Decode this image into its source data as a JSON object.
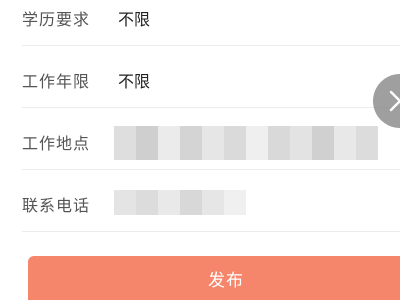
{
  "form": {
    "education": {
      "label": "学历要求",
      "value": "不限"
    },
    "work_years": {
      "label": "工作年限",
      "value": "不限"
    },
    "work_location": {
      "label": "工作地点"
    },
    "phone": {
      "label": "联系电话"
    }
  },
  "masks": {
    "location_cells": [
      "#dedede",
      "#cfcfcf",
      "#ebebeb",
      "#d4d4d4",
      "#e6e6e6",
      "#dadada",
      "#efefef",
      "#d9d9d9",
      "#e3e3e3",
      "#d0d0d0",
      "#e8e8e8",
      "#dcdcdc"
    ],
    "phone_cells": [
      "#e4e4e4",
      "#dcdcdc",
      "#e9e9e9",
      "#d8d8d8",
      "#e6e6e6",
      "#f0f0f0"
    ]
  },
  "actions": {
    "publish_label": "发布",
    "close_icon": "close-icon"
  },
  "colors": {
    "accent": "#f5866b",
    "close_button": "#8a8a8a"
  }
}
